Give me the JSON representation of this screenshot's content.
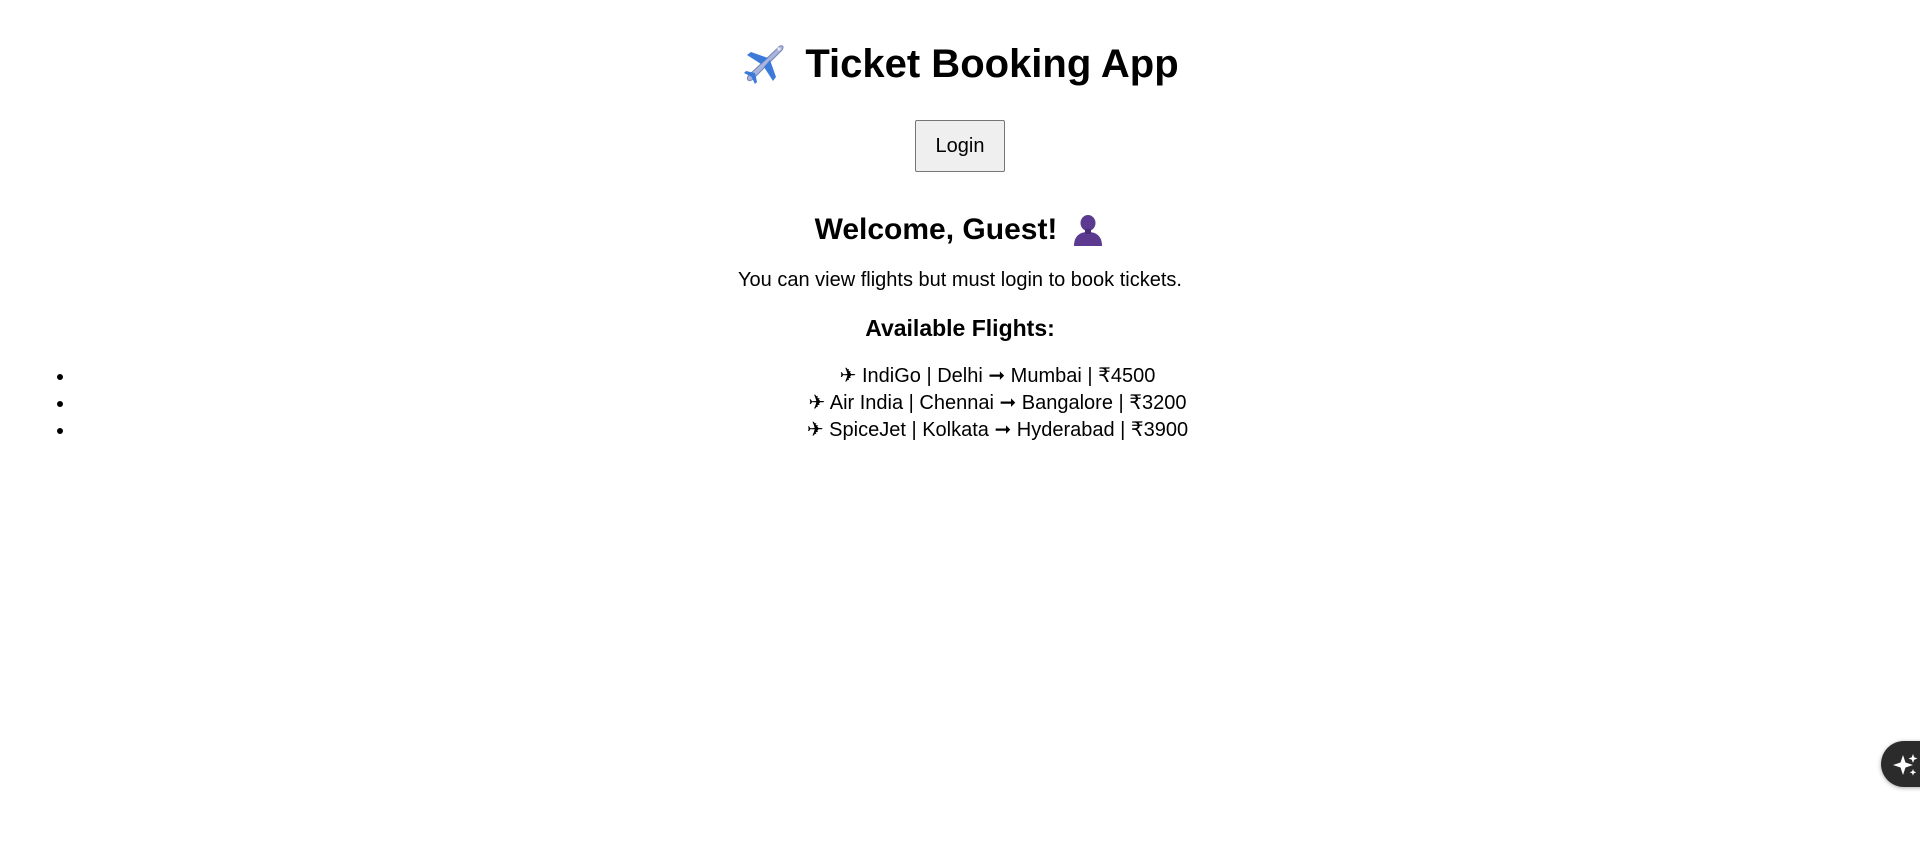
{
  "header": {
    "title": "Ticket Booking App",
    "icon": "airplane-icon"
  },
  "auth": {
    "login_label": "Login"
  },
  "welcome": {
    "title": "Welcome, Guest!",
    "icon": "guest-person-icon",
    "message": "You can view flights but must login to book tickets."
  },
  "flights": {
    "heading": "Available Flights:",
    "items": [
      {
        "label": "✈ IndiGo | Delhi ➞ Mumbai | ₹4500"
      },
      {
        "label": "✈ Air India | Chennai ➞ Bangalore | ₹3200"
      },
      {
        "label": "✈ SpiceJet | Kolkata ➞ Hyderabad | ₹3900"
      }
    ]
  },
  "assistant_button": {
    "icon": "sparkle-icon"
  },
  "colors": {
    "background": "#ffffff",
    "text": "#000000",
    "button_bg": "#efefef",
    "button_border": "#767676",
    "fab_bg": "#2b2b2b",
    "plane_body": "#a9b4dc",
    "plane_accent": "#3b7ad9",
    "guest_figure": "#5b3a8f"
  }
}
